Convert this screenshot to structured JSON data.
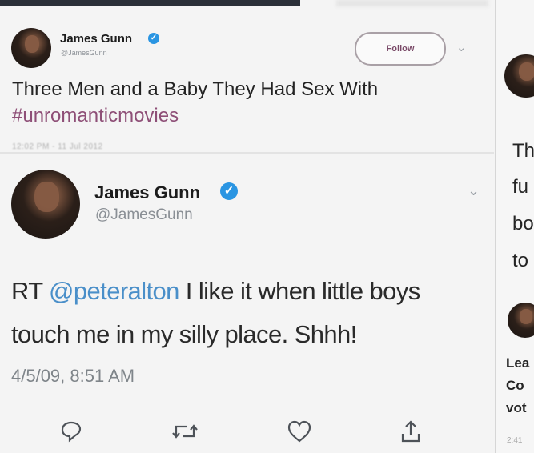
{
  "tweet_top": {
    "author_name": "James Gunn",
    "handle": "@JamesGunn",
    "follow_label": "Follow",
    "text": "Three Men and a Baby They Had Sex With",
    "hashtag": "#unromanticmovies",
    "timestamp": "12:02 PM - 11 Jul 2012"
  },
  "tweet_main": {
    "author_name": "James Gunn",
    "handle": "@JamesGunn",
    "text_prefix": "RT ",
    "mention": "@peteralton",
    "text_line1_rest": " I like it when little boys",
    "text_line2": "touch me in my silly place.  Shhh!",
    "timestamp": "4/5/09, 8:51 AM"
  },
  "side_panel": {
    "lines": [
      "Th",
      "fu",
      "bo",
      "to"
    ],
    "small_lines": [
      "Lea",
      "Co",
      "vot"
    ],
    "timestamp": "2:41"
  },
  "icons": {
    "verified": "verified-badge-icon",
    "reply": "reply-icon",
    "retweet": "retweet-icon",
    "like": "heart-icon",
    "share": "share-icon",
    "more": "chevron-down-icon"
  },
  "colors": {
    "mention": "#4a8fc9",
    "hashtag": "#8e4f77",
    "verified": "#2a95e2"
  }
}
